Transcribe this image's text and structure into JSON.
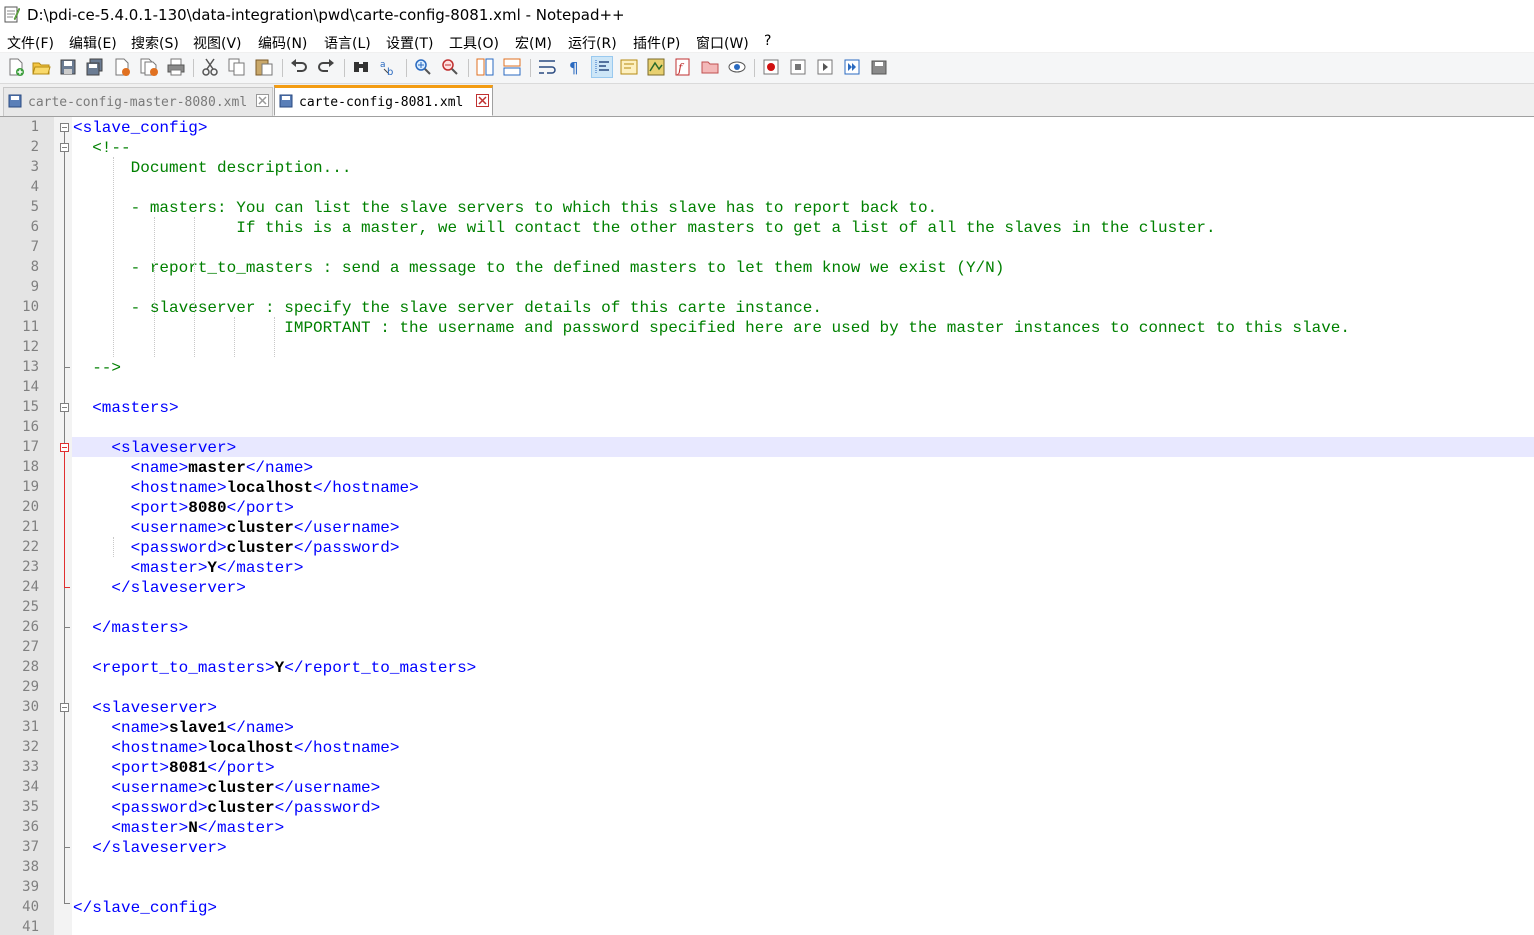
{
  "window": {
    "title": "D:\\pdi-ce-5.4.0.1-130\\data-integration\\pwd\\carte-config-8081.xml - Notepad++"
  },
  "menu": [
    "文件(F)",
    "编辑(E)",
    "搜索(S)",
    "视图(V)",
    "编码(N)",
    "语言(L)",
    "设置(T)",
    "工具(O)",
    "宏(M)",
    "运行(R)",
    "插件(P)",
    "窗口(W)",
    "?"
  ],
  "toolbar": {
    "icons": [
      "new-file-icon",
      "open-file-icon",
      "save-icon",
      "save-all-icon",
      "close-icon",
      "close-all-icon",
      "print-icon",
      "cut-icon",
      "copy-icon",
      "paste-icon",
      "undo-icon",
      "redo-icon",
      "find-icon",
      "replace-icon",
      "zoom-in-icon",
      "zoom-out-icon",
      "sync-vertical-icon",
      "sync-horizontal-icon",
      "word-wrap-icon",
      "show-all-chars-icon",
      "indent-guide-icon",
      "user-lang-icon",
      "doc-map-icon",
      "function-list-icon",
      "folder-workspace-icon",
      "monitor-icon",
      "macro-record-icon",
      "macro-stop-icon",
      "macro-play-icon",
      "macro-run-multiple-icon",
      "macro-save-icon"
    ]
  },
  "tabs": [
    {
      "label": "carte-config-master-8080.xml",
      "active": false
    },
    {
      "label": "carte-config-8081.xml",
      "active": true
    }
  ],
  "editor": {
    "current_line": 17,
    "lines": [
      {
        "n": "1",
        "segs": [
          [
            "tag",
            "<slave_config>"
          ]
        ]
      },
      {
        "n": "2",
        "segs": [
          [
            "tag",
            "  "
          ],
          [
            "cmt",
            "<!--"
          ]
        ]
      },
      {
        "n": "3",
        "segs": [
          [
            "cmt",
            "      Document description..."
          ]
        ]
      },
      {
        "n": "4",
        "segs": []
      },
      {
        "n": "5",
        "segs": [
          [
            "cmt",
            "      - masters: You can list the slave servers to which this slave has to report back to."
          ]
        ]
      },
      {
        "n": "6",
        "segs": [
          [
            "cmt",
            "                 If this is a master, we will contact the other masters to get a list of all the slaves in the cluster."
          ]
        ]
      },
      {
        "n": "7",
        "segs": []
      },
      {
        "n": "8",
        "segs": [
          [
            "cmt",
            "      - report_to_masters : send a message to the defined masters to let them know we exist (Y/N)"
          ]
        ]
      },
      {
        "n": "9",
        "segs": []
      },
      {
        "n": "10",
        "segs": [
          [
            "cmt",
            "      - slaveserver : specify the slave server details of this carte instance."
          ]
        ]
      },
      {
        "n": "11",
        "segs": [
          [
            "cmt",
            "                      IMPORTANT : the username and password specified here are used by the master instances to connect to this slave."
          ]
        ]
      },
      {
        "n": "12",
        "segs": []
      },
      {
        "n": "13",
        "segs": [
          [
            "cmt",
            "  -->"
          ]
        ]
      },
      {
        "n": "14",
        "segs": []
      },
      {
        "n": "15",
        "segs": [
          [
            "tag",
            "  <masters>"
          ]
        ]
      },
      {
        "n": "16",
        "segs": []
      },
      {
        "n": "17",
        "segs": [
          [
            "tag",
            "    <slaveserver>"
          ]
        ]
      },
      {
        "n": "18",
        "segs": [
          [
            "tag",
            "      <name>"
          ],
          [
            "val",
            "master"
          ],
          [
            "tag",
            "</name>"
          ]
        ]
      },
      {
        "n": "19",
        "segs": [
          [
            "tag",
            "      <hostname>"
          ],
          [
            "val",
            "localhost"
          ],
          [
            "tag",
            "</hostname>"
          ]
        ]
      },
      {
        "n": "20",
        "segs": [
          [
            "tag",
            "      <port>"
          ],
          [
            "val",
            "8080"
          ],
          [
            "tag",
            "</port>"
          ]
        ]
      },
      {
        "n": "21",
        "segs": [
          [
            "tag",
            "      <username>"
          ],
          [
            "val",
            "cluster"
          ],
          [
            "tag",
            "</username>"
          ]
        ]
      },
      {
        "n": "22",
        "segs": [
          [
            "tag",
            "      <password>"
          ],
          [
            "val",
            "cluster"
          ],
          [
            "tag",
            "</password>"
          ]
        ]
      },
      {
        "n": "23",
        "segs": [
          [
            "tag",
            "      <master>"
          ],
          [
            "val",
            "Y"
          ],
          [
            "tag",
            "</master>"
          ]
        ]
      },
      {
        "n": "24",
        "segs": [
          [
            "tag",
            "    </slaveserver>"
          ]
        ]
      },
      {
        "n": "25",
        "segs": []
      },
      {
        "n": "26",
        "segs": [
          [
            "tag",
            "  </masters>"
          ]
        ]
      },
      {
        "n": "27",
        "segs": []
      },
      {
        "n": "28",
        "segs": [
          [
            "tag",
            "  <report_to_masters>"
          ],
          [
            "val",
            "Y"
          ],
          [
            "tag",
            "</report_to_masters>"
          ]
        ]
      },
      {
        "n": "29",
        "segs": []
      },
      {
        "n": "30",
        "segs": [
          [
            "tag",
            "  <slaveserver>"
          ]
        ]
      },
      {
        "n": "31",
        "segs": [
          [
            "tag",
            "    <name>"
          ],
          [
            "val",
            "slave1"
          ],
          [
            "tag",
            "</name>"
          ]
        ]
      },
      {
        "n": "32",
        "segs": [
          [
            "tag",
            "    <hostname>"
          ],
          [
            "val",
            "localhost"
          ],
          [
            "tag",
            "</hostname>"
          ]
        ]
      },
      {
        "n": "33",
        "segs": [
          [
            "tag",
            "    <port>"
          ],
          [
            "val",
            "8081"
          ],
          [
            "tag",
            "</port>"
          ]
        ]
      },
      {
        "n": "34",
        "segs": [
          [
            "tag",
            "    <username>"
          ],
          [
            "val",
            "cluster"
          ],
          [
            "tag",
            "</username>"
          ]
        ]
      },
      {
        "n": "35",
        "segs": [
          [
            "tag",
            "    <password>"
          ],
          [
            "val",
            "cluster"
          ],
          [
            "tag",
            "</password>"
          ]
        ]
      },
      {
        "n": "36",
        "segs": [
          [
            "tag",
            "    <master>"
          ],
          [
            "val",
            "N"
          ],
          [
            "tag",
            "</master>"
          ]
        ]
      },
      {
        "n": "37",
        "segs": [
          [
            "tag",
            "  </slaveserver>"
          ]
        ]
      },
      {
        "n": "38",
        "segs": []
      },
      {
        "n": "39",
        "segs": []
      },
      {
        "n": "40",
        "segs": [
          [
            "tag",
            "</slave_config>"
          ]
        ]
      },
      {
        "n": "41",
        "segs": []
      }
    ]
  },
  "colors": {
    "tag": "#0000ff",
    "comment": "#008000",
    "value": "#000000",
    "current_line_bg": "#e8e8ff",
    "fold_highlight": "#e03030"
  }
}
